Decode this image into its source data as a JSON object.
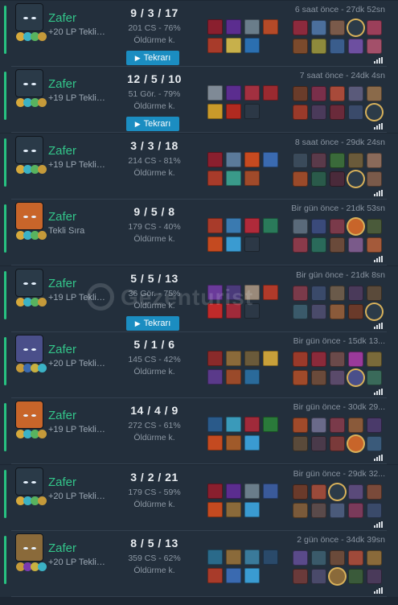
{
  "labels": {
    "win": "Zafer",
    "replay": "Tekrarı",
    "multikill": "Öldürme k."
  },
  "colors": {
    "background": "#1d2733",
    "row": "#232f3c",
    "win": "#33c58a",
    "replay_button": "#1b8dc1",
    "self_highlight": "#d8b15a"
  },
  "watermark": "Gezenturist",
  "matches": [
    {
      "champion_icon": "dark-hooded-champion-portrait",
      "result": "Zafer",
      "lp": "+20 LP Tekli ...",
      "kda": "9 / 3 / 17",
      "cs": "201 CS - 76%",
      "multikill": "Öldürme k.",
      "has_replay": true,
      "time": "6 saat önce - 27dk 52sn",
      "champ_color": "#2a3a48",
      "rune_colors": [
        "#d6a93c",
        "#3bb2c5",
        "#58b35f",
        "#c59a3a"
      ],
      "items": [
        "#8a1f2e",
        "#5b2d8f",
        "#6a7d8a",
        "#b54a28",
        "#a83b2a",
        "#c7b04b",
        "#2b6fb0"
      ],
      "trinket": "#3a9bd1",
      "blue_team": [
        "#8c2a3d",
        "#4b6f9c",
        "#7a5a4a",
        "#2c3b48",
        "#9b3f5a"
      ],
      "red_team": [
        "#7b4a2c",
        "#8e8a3c",
        "#3a5d8c",
        "#6d4fa0",
        "#a3506a"
      ],
      "self_index": 3,
      "self_team": "blue"
    },
    {
      "champion_icon": "dark-hooded-champion-portrait",
      "result": "Zafer",
      "lp": "+19 LP Tekli ...",
      "kda": "12 / 5 / 10",
      "cs": "51 Gör. - 79%",
      "multikill": "Öldürme k.",
      "has_replay": true,
      "time": "7 saat önce - 24dk 4sn",
      "champ_color": "#2a3a48",
      "rune_colors": [
        "#d6a93c",
        "#3bb2c5",
        "#58b35f",
        "#c59a3a"
      ],
      "items": [
        "#7f8a96",
        "#5b2d8f",
        "#a23040",
        "#9a2a30",
        "#c99a2a",
        "#b02a20",
        ""
      ],
      "trinket": "",
      "blue_team": [
        "#6a3c2a",
        "#7a2f4a",
        "#a84a3a",
        "#5a5a7a",
        "#8a6a4a"
      ],
      "red_team": [
        "#9a3a2a",
        "#4a3a5a",
        "#6a2a3a",
        "#3a4a6a",
        "#2c3b48"
      ],
      "self_index": 4,
      "self_team": "red"
    },
    {
      "champion_icon": "dark-hooded-champion-portrait",
      "result": "Zafer",
      "lp": "+19 LP Tekli ...",
      "kda": "3 / 3 / 18",
      "cs": "214 CS - 81%",
      "multikill": "Öldürme k.",
      "has_replay": false,
      "time": "8 saat önce - 29dk 24sn",
      "champ_color": "#2a3a48",
      "rune_colors": [
        "#d6a93c",
        "#3bb2c5",
        "#58b35f",
        "#c59a3a"
      ],
      "items": [
        "#8a1f2e",
        "#5b7a9a",
        "#c64a20",
        "#3a6ab0",
        "#a83b2a",
        "#3a9a8a",
        "#a04a2a"
      ],
      "trinket": "#3a9bd1",
      "blue_team": [
        "#3a4a5a",
        "#5a3a4a",
        "#3a6a3a",
        "#6a5a3a",
        "#8a6a5a"
      ],
      "red_team": [
        "#9a4a2a",
        "#2a5a4a",
        "#4a2a3a",
        "#2c3b48",
        "#7a5a4a"
      ],
      "self_index": 3,
      "self_team": "red"
    },
    {
      "champion_icon": "orange-yordle-champion-portrait",
      "result": "Zafer",
      "lp": "Tekli Sıra",
      "kda": "9 / 5 / 8",
      "cs": "179 CS - 40%",
      "multikill": "Öldürme k.",
      "has_replay": false,
      "time": "Bir gün önce - 21dk 53sn",
      "champ_color": "#c8652a",
      "rune_colors": [
        "#d6a93c",
        "#3bb2c5",
        "#58b35f",
        "#c59a3a"
      ],
      "items": [
        "#a83b2a",
        "#3a7ab0",
        "#b02a3a",
        "#2a7a5a",
        "#c44a20",
        "#3a9bd1",
        ""
      ],
      "trinket": "",
      "blue_team": [
        "#5a6a7a",
        "#3a4a7a",
        "#7a3a4a",
        "#c8652a",
        "#4a5a3a"
      ],
      "red_team": [
        "#8a3a4a",
        "#2a6a5a",
        "#6a4a3a",
        "#7a5a8a",
        "#a45a3a"
      ],
      "self_index": 3,
      "self_team": "blue"
    },
    {
      "champion_icon": "dark-hooded-champion-portrait",
      "result": "Zafer",
      "lp": "+19 LP Tekli ...",
      "kda": "5 / 5 / 13",
      "cs": "36 Gör. - 75%",
      "multikill": "Öldürme k.",
      "has_replay": true,
      "time": "Bir gün önce - 21dk 8sn",
      "champ_color": "#2a3a48",
      "rune_colors": [
        "#d6a93c",
        "#3bb2c5",
        "#58b35f",
        "#c59a3a"
      ],
      "items": [
        "#6a3a9a",
        "#4a3a7a",
        "#9a8a7a",
        "#b03a2a",
        "#c02a2a",
        "#a02a3a",
        ""
      ],
      "trinket": "",
      "blue_team": [
        "#7a3a4a",
        "#3a4a6a",
        "#6a5a4a",
        "#4a3a5a",
        "#5a4a3a"
      ],
      "red_team": [
        "#3a5a6a",
        "#4a4a6a",
        "#8a5a3a",
        "#6a3a2a",
        "#2c3b48"
      ],
      "self_index": 4,
      "self_team": "red"
    },
    {
      "champion_icon": "pale-dark-champion-portrait",
      "result": "Zafer",
      "lp": "+20 LP Tekli ...",
      "kda": "5 / 1 / 6",
      "cs": "145 CS - 42%",
      "multikill": "Öldürme k.",
      "has_replay": false,
      "time": "Bir gün önce - 15dk 13...",
      "champ_color": "#4a4f8a",
      "rune_colors": [
        "#c59a3a",
        "#3a6ab0",
        "#c8b040",
        "#3bb2c5"
      ],
      "items": [
        "#8a2a2a",
        "#8a6a3a",
        "#6a5a3a",
        "#c8a03a",
        "#5a3a8a",
        "#9a4a2a",
        "#2a6a9a"
      ],
      "trinket": "#3a9bd1",
      "blue_team": [
        "#9a3a2a",
        "#8a2a3a",
        "#6a4a4a",
        "#9a3a9a",
        "#7a6a3a"
      ],
      "red_team": [
        "#a04a2a",
        "#6a4a3a",
        "#5a4a6a",
        "#4a4f8a",
        "#3a6a5a"
      ],
      "self_index": 3,
      "self_team": "red"
    },
    {
      "champion_icon": "orange-yordle-champion-portrait",
      "result": "Zafer",
      "lp": "+19 LP Tekli ...",
      "kda": "14 / 4 / 9",
      "cs": "272 CS - 61%",
      "multikill": "Öldürme k.",
      "has_replay": false,
      "time": "Bir gün önce - 30dk 29...",
      "champ_color": "#c8652a",
      "rune_colors": [
        "#d6a93c",
        "#3bb2c5",
        "#58b35f",
        "#c59a3a"
      ],
      "items": [
        "#2a5a8a",
        "#3a9aba",
        "#a02a3a",
        "#2a7a3a",
        "#c44a20",
        "#a05a2a",
        "#3a9bd1"
      ],
      "trinket": "#3a9bd1",
      "blue_team": [
        "#a04a2a",
        "#6a6a8a",
        "#7a3a4a",
        "#8a5a3a",
        "#4a3a6a"
      ],
      "red_team": [
        "#5a4a3a",
        "#4a3a4a",
        "#7a3a3a",
        "#c8652a",
        "#3a5a7a"
      ],
      "self_index": 3,
      "self_team": "red"
    },
    {
      "champion_icon": "dark-hooded-champion-portrait",
      "result": "Zafer",
      "lp": "+20 LP Tekli ...",
      "kda": "3 / 2 / 21",
      "cs": "179 CS - 59%",
      "multikill": "Öldürme k.",
      "has_replay": false,
      "time": "Bir gün önce - 29dk 32...",
      "champ_color": "#2a3a48",
      "rune_colors": [
        "#d6a93c",
        "#3bb2c5",
        "#58b35f",
        "#c59a3a"
      ],
      "items": [
        "#8a1f2e",
        "#5b2d8f",
        "#6a7d8a",
        "#3a5a9a",
        "#c44a20",
        "#8a6a3a",
        "#3a9bd1"
      ],
      "trinket": "#3a9bd1",
      "blue_team": [
        "#6a3a2a",
        "#9a4a3a",
        "#2c3b48",
        "#5a4a7a",
        "#7a4a3a"
      ],
      "red_team": [
        "#7a5a3a",
        "#5a4a4a",
        "#4a5a7a",
        "#7a3a5a",
        "#3a4a6a"
      ],
      "self_index": 2,
      "self_team": "blue"
    },
    {
      "champion_icon": "golden-armored-champion-portrait",
      "result": "Zafer",
      "lp": "+20 LP Tekli ...",
      "kda": "8 / 5 / 13",
      "cs": "359 CS - 62%",
      "multikill": "Öldürme k.",
      "has_replay": false,
      "time": "2 gün önce - 34dk 39sn",
      "champ_color": "#8a6a3a",
      "rune_colors": [
        "#c59a3a",
        "#7a3ab0",
        "#c8b040",
        "#3bb2c5"
      ],
      "items": [
        "#2a6a8a",
        "#8a6a3a",
        "#3a7a9a",
        "#2a4a6a",
        "#a83b2a",
        "#3a6ab0",
        "#3a9bd1"
      ],
      "trinket": "#3a9bd1",
      "blue_team": [
        "#5a4a8a",
        "#3a5a6a",
        "#6a4a3a",
        "#a04a3a",
        "#8a6a3a"
      ],
      "red_team": [
        "#6a3a3a",
        "#4a4a6a",
        "#8a6a3a",
        "#3a5a3a",
        "#4a3a5a"
      ],
      "self_index": 2,
      "self_team": "red"
    }
  ]
}
